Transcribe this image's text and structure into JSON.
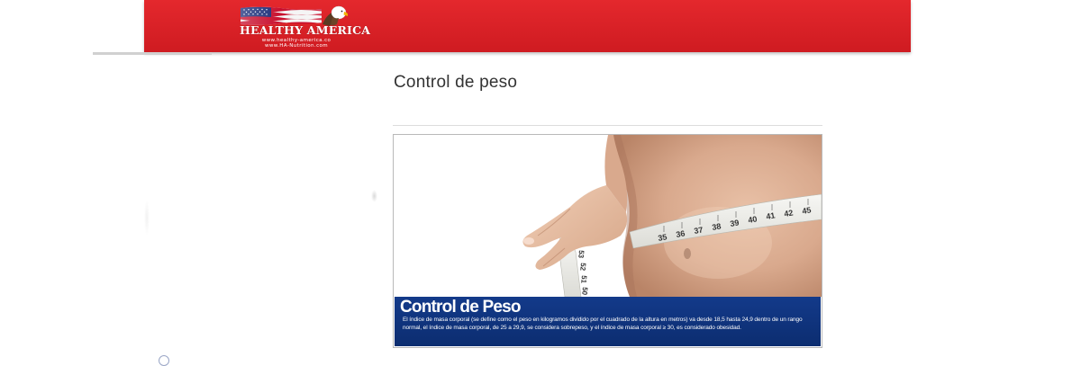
{
  "colors": {
    "header_red": "#d9222a",
    "banner_blue": "#0f3278",
    "title_text": "#333333"
  },
  "header": {
    "logo": {
      "name": "HEALTHY AMERICA",
      "url_primary": "www.healthy-america.co",
      "url_secondary": "www.HA-Nutrition.com",
      "icons": [
        "american-flag-icon",
        "eagle-icon"
      ]
    }
  },
  "main": {
    "page_title": "Control de peso",
    "banner": {
      "image_icon": "measuring-tape-waist-photo",
      "heading": "Control de Peso",
      "description": "El índice de masa corporal (se define como el peso en kilogramos dividido por el cuadrado de la altura en metros) va desde 18,5 hasta 24,9 dentro de un rango normal, el índice de masa corporal, de 25 a 29,9, se considera sobrepeso,  y el índice de masa corporal ≥ 30, es considerado obesidad.",
      "tape_numbers": [
        "35",
        "36",
        "37",
        "38",
        "39",
        "40",
        "41",
        "42",
        "43",
        "45",
        "53",
        "52",
        "51",
        "50",
        "49"
      ]
    }
  }
}
